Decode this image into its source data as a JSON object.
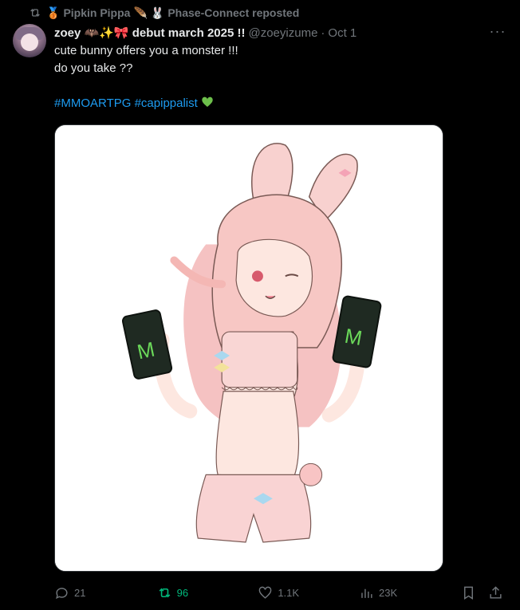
{
  "repost": {
    "icon": "repost-icon",
    "reposters": "Pipkin Pippa",
    "second": "Phase-Connect reposted"
  },
  "author": {
    "name": "zoey",
    "name_suffix": "debut march 2025 !!",
    "handle": "@zoeyizume",
    "separator": "·",
    "time": "Oct 1"
  },
  "more": {
    "label": "···"
  },
  "tweet": {
    "line1": "cute bunny offers you a monster !!!",
    "line2": "do you take ??",
    "hashtag1": "#MMOARTPG",
    "hashtag2": "#capippalist"
  },
  "media": {
    "description_icon": "bunny-girl-illustration",
    "can_text": "M"
  },
  "actions": {
    "replies": "21",
    "reposts": "96",
    "likes": "1.1K",
    "views": "23K"
  },
  "colors": {
    "accent": "#1d9bf0",
    "repost_green": "#00ba7c",
    "muted": "#71767b"
  }
}
